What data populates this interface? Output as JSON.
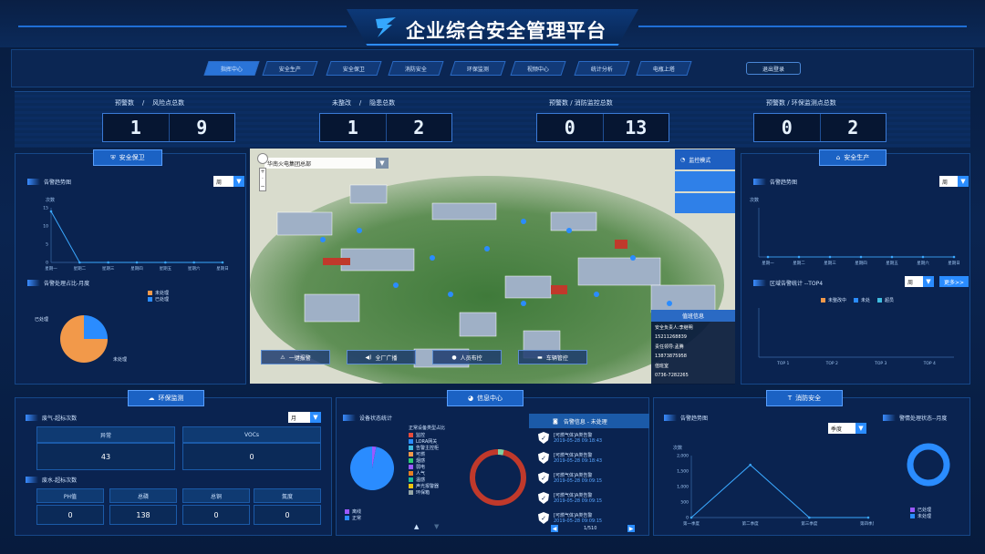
{
  "app": {
    "title": "企业综合安全管理平台",
    "logout": "退出登录"
  },
  "nav": [
    "指挥中心",
    "安全生产",
    "安全保卫",
    "消防安全",
    "环保监测",
    "视频中心",
    "统计分析",
    "电瓶上塔"
  ],
  "stats": [
    {
      "label": "预警数    /    风险点总数",
      "digits": [
        "1",
        "9"
      ]
    },
    {
      "label": "未整改    /    隐患总数",
      "digits": [
        "1",
        "2"
      ]
    },
    {
      "label": "预警数 / 消防监控总数",
      "digits": [
        "0",
        "13"
      ]
    },
    {
      "label": "预警数 / 环保监测点总数",
      "digits": [
        "0",
        "2"
      ]
    }
  ],
  "security": {
    "tab": "安全保卫",
    "alarm_title": "告警趋势图",
    "period": "周",
    "yaxis_label": "次数",
    "yticks": [
      "15",
      "10",
      "5",
      "0"
    ],
    "xticks": [
      "星期一",
      "星期二",
      "星期三",
      "星期四",
      "星期五",
      "星期六",
      "星期日"
    ],
    "handle_title": "告警处理占比-月度",
    "legend": [
      "未处理",
      "已处理"
    ],
    "pie_labels": [
      "已处理",
      "未处理"
    ]
  },
  "production": {
    "tab": "安全生产",
    "alarm_title": "告警趋势图",
    "period": "周",
    "yaxis_label": "次数",
    "xticks": [
      "星期一",
      "星期二",
      "星期三",
      "星期四",
      "星期五",
      "星期六",
      "星期日"
    ],
    "region_title": "区域告警统计 --TOP4",
    "region_period": "周",
    "detail_btn": "更多>>",
    "legend": [
      "未整改中",
      "未处",
      "超员"
    ],
    "top_labels": [
      "TOP 1",
      "TOP 2",
      "TOP 3",
      "TOP 4"
    ]
  },
  "map": {
    "area_select": "华南火电集团总部",
    "monitor_mode": "监控模式",
    "buttons": [
      "一键报警",
      "全厂广播",
      "人员布控",
      "车辆管控"
    ],
    "info_title": "值班信息",
    "info_lines": [
      "安全负责人:李继明",
      "15211268839",
      "责任领导:孟腾",
      "13873875958",
      "值班室",
      "0736-7282265"
    ]
  },
  "env": {
    "tab": "环保监测",
    "gas_title": "废气-超标次数",
    "period": "月",
    "gas_cols": [
      "异常",
      "VOCs"
    ],
    "gas_vals": [
      "43",
      "0"
    ],
    "water_title": "废水-超标次数",
    "water_cols": [
      "PH值",
      "总磷",
      "总铜",
      "氮度"
    ],
    "water_vals": [
      "0",
      "138",
      "0",
      "0"
    ]
  },
  "info_center": {
    "tab": "信息中心",
    "device_title": "设备状态统计",
    "ratio_title": "正常设备类型占比",
    "device_legend": [
      "离线",
      "正常"
    ],
    "type_list": [
      "监控",
      "LORA网关",
      "告警主控柜",
      "可燃",
      "烟感",
      "弱电",
      "人气",
      "温感",
      "声光报警器",
      "环保箱"
    ],
    "alarm_header": "告警信息 - 未处理",
    "alarm_items": [
      {
        "title": "[可燃气体]A类告警",
        "time": "2019-05-28 09:18:43"
      },
      {
        "title": "[可燃气体]A类告警",
        "time": "2019-05-28 09:18:43"
      },
      {
        "title": "[可燃气体]A类告警",
        "time": "2019-05-28 09:09:15"
      },
      {
        "title": "[可燃气体]A类告警",
        "time": "2019-05-28 09:09:15"
      },
      {
        "title": "[可燃气体]A类告警",
        "time": "2019-05-28 09:09:15"
      }
    ],
    "pager": "1/510"
  },
  "fire": {
    "tab": "消防安全",
    "alarm_title": "告警趋势图",
    "handle_title": "警情处理状态--月度",
    "period": "季度",
    "yaxis_label": "次数",
    "yticks": [
      "2,000",
      "1,500",
      "1,000",
      "500",
      "0"
    ],
    "xticks": [
      "第一季度",
      "第二季度",
      "第三季度",
      "第四季度"
    ],
    "legend": [
      "已处理",
      "未处理"
    ]
  },
  "chart_data": [
    {
      "type": "line",
      "title": "告警趋势图",
      "categories": [
        "星期一",
        "星期二",
        "星期三",
        "星期四",
        "星期五",
        "星期六",
        "星期日"
      ],
      "values": [
        14,
        0,
        0,
        0,
        0,
        0,
        0
      ],
      "ylim": [
        0,
        15
      ],
      "ylabel": "次数"
    },
    {
      "type": "pie",
      "title": "告警处理占比-月度",
      "labels": [
        "已处理",
        "未处理"
      ],
      "values": [
        25,
        75
      ],
      "colors": [
        "#2a8cff",
        "#f2994a"
      ]
    },
    {
      "type": "line",
      "title": "告警趋势图",
      "categories": [
        "第一季度",
        "第二季度",
        "第三季度",
        "第四季度"
      ],
      "values": [
        0,
        1700,
        0,
        0
      ],
      "ylim": [
        0,
        2000
      ],
      "ylabel": "次数"
    },
    {
      "type": "pie",
      "title": "设备状态统计",
      "labels": [
        "离线",
        "正常"
      ],
      "values": [
        3,
        97
      ],
      "colors": [
        "#9b59ff",
        "#2a8cff"
      ]
    }
  ]
}
